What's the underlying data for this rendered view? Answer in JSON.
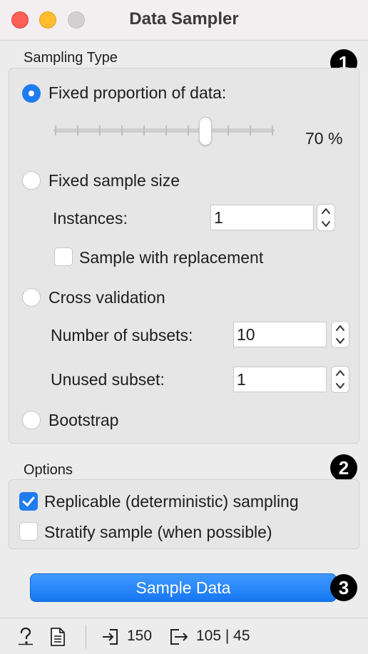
{
  "window": {
    "title": "Data Sampler"
  },
  "sampling": {
    "section_label": "Sampling Type",
    "badge": "1",
    "fixed_proportion": {
      "label": "Fixed proportion of data:",
      "selected": true,
      "value_label": "70 %",
      "value": 70
    },
    "fixed_size": {
      "label": "Fixed sample size",
      "selected": false,
      "instances_label": "Instances:",
      "instances_value": "1",
      "replacement_label": "Sample with replacement",
      "replacement_checked": false
    },
    "cross_validation": {
      "label": "Cross validation",
      "selected": false,
      "subsets_label": "Number of subsets:",
      "subsets_value": "10",
      "unused_label": "Unused subset:",
      "unused_value": "1"
    },
    "bootstrap": {
      "label": "Bootstrap",
      "selected": false
    }
  },
  "options": {
    "section_label": "Options",
    "badge": "2",
    "replicable": {
      "label": "Replicable (deterministic) sampling",
      "checked": true
    },
    "stratify": {
      "label": "Stratify sample (when possible)",
      "checked": false
    }
  },
  "action": {
    "label": "Sample Data",
    "badge": "3"
  },
  "status": {
    "input_count": "150",
    "output_count": "105 | 45"
  },
  "colors": {
    "accent": "#1f7cf0",
    "close": "#fe5f57",
    "minimize": "#febc2e",
    "maximize": "#d4d0d2"
  },
  "icons": [
    "help-icon",
    "report-icon",
    "input-icon",
    "output-icon",
    "chevron-up-icon",
    "chevron-down-icon"
  ]
}
